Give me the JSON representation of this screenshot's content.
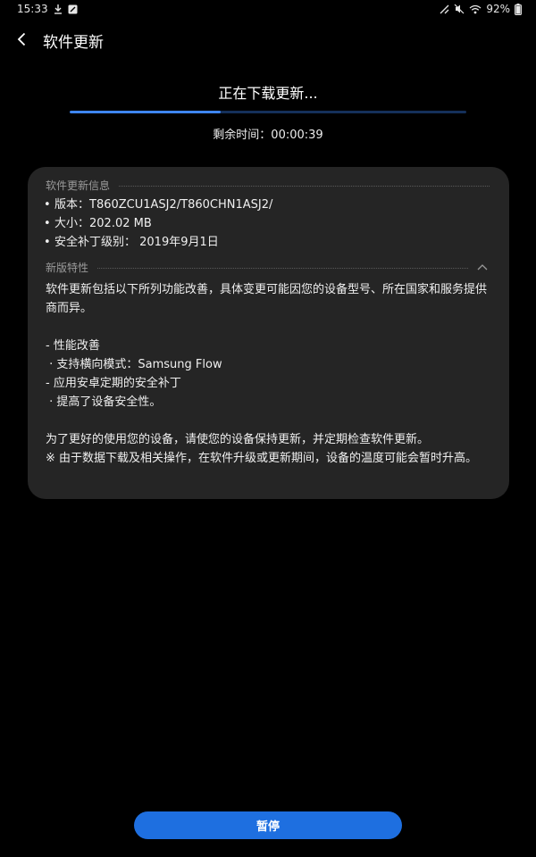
{
  "status_bar": {
    "time": "15:33",
    "battery_percent": "92%",
    "icons_left": [
      "download-icon",
      "notification-icon"
    ],
    "icons_right": [
      "nfc-icon",
      "mute-icon",
      "wifi-icon",
      "battery-icon"
    ]
  },
  "header": {
    "back_icon": "back-arrow-icon",
    "title": "软件更新"
  },
  "download": {
    "status_text": "正在下载更新...",
    "progress_fraction": 0.38,
    "remaining_text": "剩余时间：00:00:39",
    "progress_color": "#3e86f5",
    "track_color": "#15305a"
  },
  "info_card": {
    "info_section_title": "软件更新信息",
    "items": [
      {
        "bullet": "•",
        "text": "版本：T860ZCU1ASJ2/T860CHN1ASJ2/"
      },
      {
        "bullet": "•",
        "text": "大小：202.02 MB"
      },
      {
        "bullet": "•",
        "text": "安全补丁级别： 2019年9月1日"
      }
    ],
    "features_section_title": "新版特性",
    "features_collapse_icon": "chevron-up-icon",
    "features_lines": [
      "软件更新包括以下所列功能改善，具体变更可能因您的设备型号、所在国家和服务提供商而异。",
      "",
      "- 性能改善",
      " · 支持横向模式：Samsung Flow",
      "- 应用安卓定期的安全补丁",
      " · 提高了设备安全性。",
      "",
      "为了更好的使用您的设备，请使您的设备保持更新，并定期检查软件更新。",
      "※ 由于数据下载及相关操作，在软件升级或更新期间，设备的温度可能会暂时升高。"
    ]
  },
  "actions": {
    "pause_label": "暂停",
    "pause_color": "#1e6fe0"
  }
}
